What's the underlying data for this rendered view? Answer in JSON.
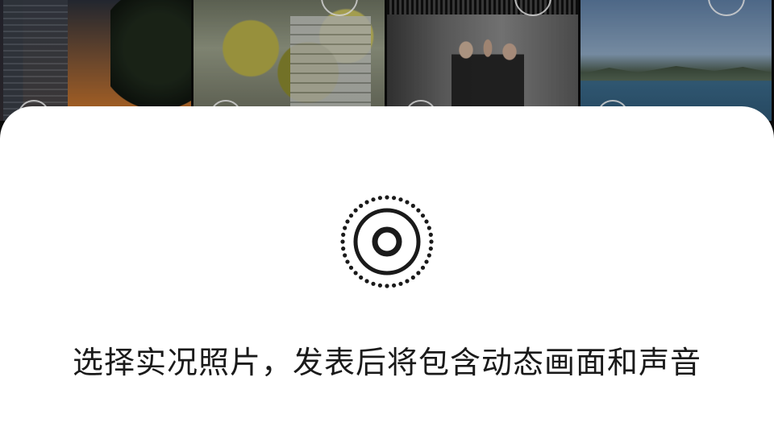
{
  "photos": [
    {
      "name": "photo-city-sunset",
      "selected": false
    },
    {
      "name": "photo-yellow-tree",
      "selected": false
    },
    {
      "name": "photo-people-hallway",
      "selected": false
    },
    {
      "name": "photo-sea-view",
      "selected": false
    }
  ],
  "sheet": {
    "icon": "live-photo-icon",
    "message": "选择实况照片，发表后将包含动态画面和声音"
  },
  "colors": {
    "sheet_background": "#ffffff",
    "text": "#1a1a1a",
    "icon": "#1a1a1a"
  }
}
